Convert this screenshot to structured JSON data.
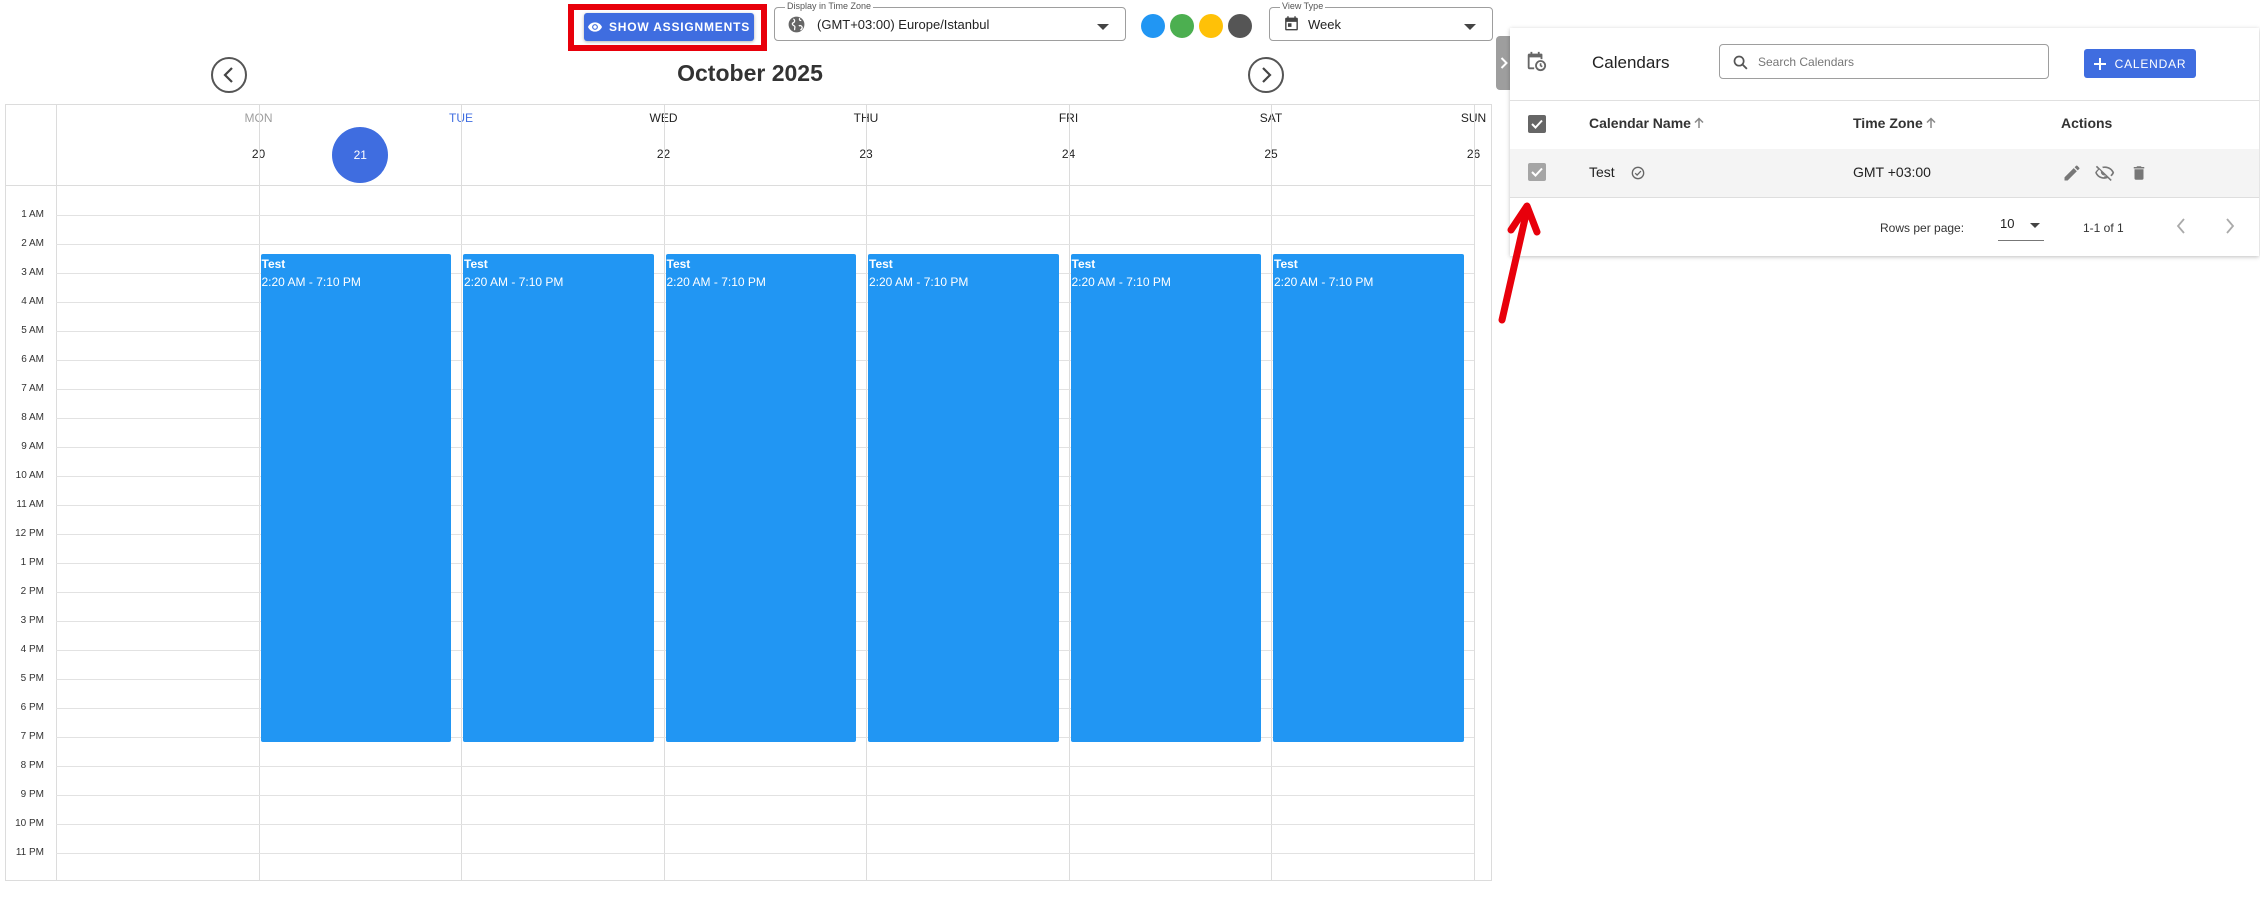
{
  "toolbar": {
    "show_assignments_label": "SHOW ASSIGNMENTS",
    "timezone": {
      "label": "Display in Time Zone",
      "value": "(GMT+03:00) Europe/Istanbul"
    },
    "view_type": {
      "label": "View Type",
      "value": "Week"
    },
    "color_dots": [
      "#2196f3",
      "#4caf50",
      "#ffc107",
      "#555555"
    ]
  },
  "calendar": {
    "month_title": "October 2025",
    "days": [
      {
        "name": "MON",
        "num": "20",
        "muted": true,
        "today": false
      },
      {
        "name": "TUE",
        "num": "21",
        "muted": false,
        "today": true
      },
      {
        "name": "WED",
        "num": "22",
        "muted": false,
        "today": false
      },
      {
        "name": "THU",
        "num": "23",
        "muted": false,
        "today": false
      },
      {
        "name": "FRI",
        "num": "24",
        "muted": false,
        "today": false
      },
      {
        "name": "SAT",
        "num": "25",
        "muted": false,
        "today": false
      },
      {
        "name": "SUN",
        "num": "26",
        "muted": false,
        "today": false
      }
    ],
    "hours": [
      "1 AM",
      "2 AM",
      "3 AM",
      "4 AM",
      "5 AM",
      "6 AM",
      "7 AM",
      "8 AM",
      "9 AM",
      "10 AM",
      "11 AM",
      "12 PM",
      "1 PM",
      "2 PM",
      "3 PM",
      "4 PM",
      "5 PM",
      "6 PM",
      "7 PM",
      "8 PM",
      "9 PM",
      "10 PM",
      "11 PM"
    ],
    "events": [
      {
        "title": "Test",
        "time": "2:20 AM - 7:10 PM",
        "day_index": 1
      },
      {
        "title": "Test",
        "time": "2:20 AM - 7:10 PM",
        "day_index": 2
      },
      {
        "title": "Test",
        "time": "2:20 AM - 7:10 PM",
        "day_index": 3
      },
      {
        "title": "Test",
        "time": "2:20 AM - 7:10 PM",
        "day_index": 4
      },
      {
        "title": "Test",
        "time": "2:20 AM - 7:10 PM",
        "day_index": 5
      },
      {
        "title": "Test",
        "time": "2:20 AM - 7:10 PM",
        "day_index": 6
      }
    ],
    "event_color": "#2196f3"
  },
  "panel": {
    "title": "Calendars",
    "search_placeholder": "Search Calendars",
    "add_label": "CALENDAR",
    "columns": {
      "name": "Calendar Name",
      "timezone": "Time Zone",
      "actions": "Actions"
    },
    "rows": [
      {
        "name": "Test",
        "timezone": "GMT +03:00"
      }
    ],
    "pagination": {
      "rows_per_page_label": "Rows per page:",
      "rows_per_page": "10",
      "range": "1-1 of 1"
    }
  },
  "accent_color": "#3f6de0",
  "annotation_color": "#e8000b"
}
